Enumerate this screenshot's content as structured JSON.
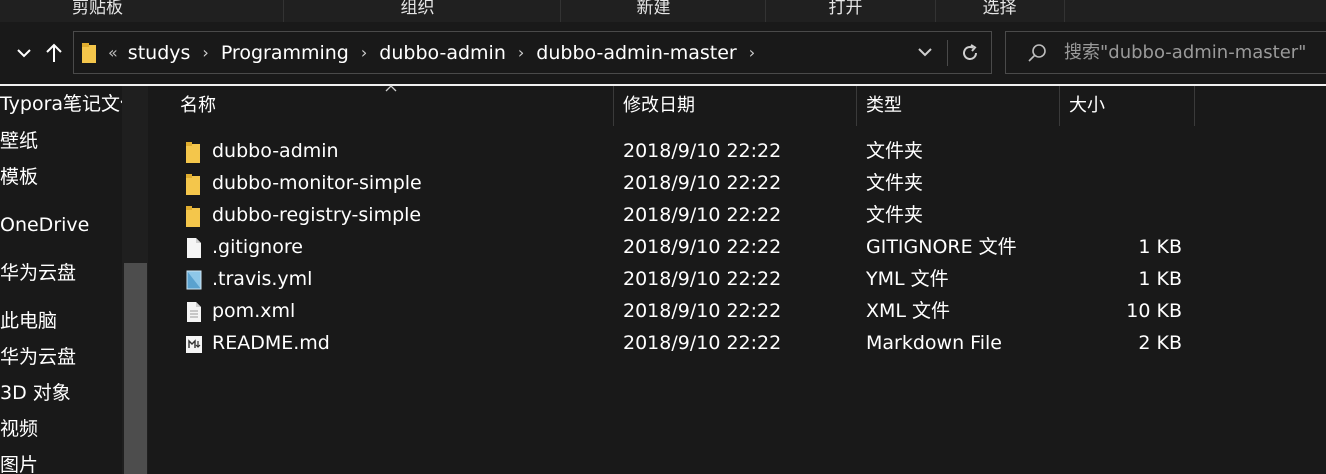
{
  "ribbon": {
    "groups": [
      "剪贴板",
      "组织",
      "新建",
      "打开",
      "选择"
    ]
  },
  "nav": {
    "up_arrow": "↑",
    "recent": "⌄"
  },
  "address": {
    "overflow": "«",
    "crumbs": [
      "studys",
      "Programming",
      "dubbo-admin",
      "dubbo-admin-master"
    ],
    "separator": "›"
  },
  "search": {
    "placeholder": "搜索\"dubbo-admin-master\""
  },
  "sidebar": {
    "items": [
      "Typora笔记文件",
      "壁纸",
      "模板",
      "OneDrive",
      "华为云盘",
      "此电脑",
      "华为云盘",
      "3D 对象",
      "视频",
      "图片"
    ]
  },
  "columns": {
    "name": "名称",
    "date": "修改日期",
    "type": "类型",
    "size": "大小"
  },
  "files": [
    {
      "name": "dubbo-admin",
      "date": "2018/9/10 22:22",
      "type": "文件夹",
      "size": "",
      "icon": "folder-icon"
    },
    {
      "name": "dubbo-monitor-simple",
      "date": "2018/9/10 22:22",
      "type": "文件夹",
      "size": "",
      "icon": "folder-icon"
    },
    {
      "name": "dubbo-registry-simple",
      "date": "2018/9/10 22:22",
      "type": "文件夹",
      "size": "",
      "icon": "folder-icon"
    },
    {
      "name": ".gitignore",
      "date": "2018/9/10 22:22",
      "type": "GITIGNORE 文件",
      "size": "1 KB",
      "icon": "file-icon"
    },
    {
      "name": ".travis.yml",
      "date": "2018/9/10 22:22",
      "type": "YML 文件",
      "size": "1 KB",
      "icon": "yml-file-icon"
    },
    {
      "name": "pom.xml",
      "date": "2018/9/10 22:22",
      "type": "XML 文件",
      "size": "10 KB",
      "icon": "file-icon"
    },
    {
      "name": "README.md",
      "date": "2018/9/10 22:22",
      "type": "Markdown File",
      "size": "2 KB",
      "icon": "markdown-file-icon"
    }
  ],
  "colors": {
    "background": "#191919",
    "folder": "#f4c64b",
    "text": "#ffffff"
  }
}
